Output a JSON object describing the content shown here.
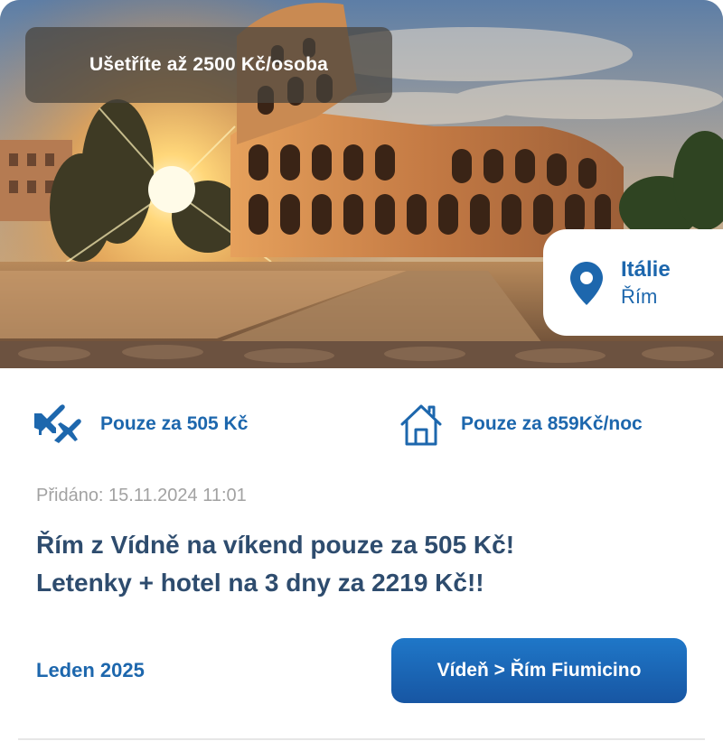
{
  "hero": {
    "savings_badge": "Ušetříte až 2500 Kč/osoba",
    "location": {
      "country": "Itálie",
      "city": "Řím",
      "icon": "map-pin-icon"
    }
  },
  "info": {
    "flight": {
      "icon": "airplanes-icon",
      "price_text": "Pouze za 505 Kč"
    },
    "hotel": {
      "icon": "house-icon",
      "price_text": "Pouze za 859Kč/noc"
    }
  },
  "post": {
    "added": "Přidáno: 15.11.2024 11:01",
    "headline_line1": "Řím z Vídně na víkend pouze za 505 Kč!",
    "headline_line2": "Letenky + hotel na 3 dny za 2219 Kč!!"
  },
  "footer": {
    "month": "Leden 2025",
    "route_button": "Vídeň > Řím Fiumicino"
  },
  "colors": {
    "brand_blue": "#1d67ad",
    "headline": "#2e4c6e",
    "muted": "#a2a2a2",
    "button": "#1f6fbf"
  }
}
